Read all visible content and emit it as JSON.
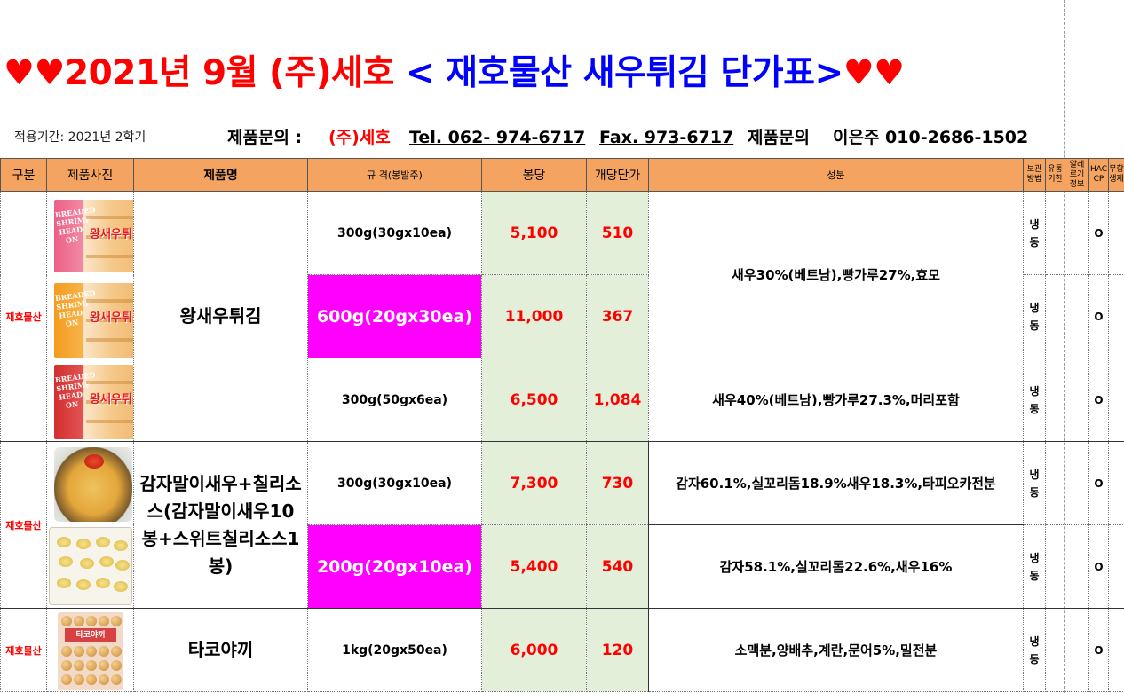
{
  "title": {
    "hearts_left": "♥♥",
    "red_part": "2021년 9월 (주)세호",
    "blue_part": "< 재호물산 새우튀김 단가표>",
    "hearts_right": "♥♥"
  },
  "info": {
    "period": "적용기간: 2021년 2학기",
    "inquiry_label": "제품문의 :",
    "company": "(주)세호",
    "tel": "Tel. 062- 974-6717",
    "fax": "Fax. 973-6717",
    "inquiry_label2": "제품문의",
    "contact": "이은주 010-2686-1502"
  },
  "headers": {
    "gubun": "구분",
    "photo": "제품사진",
    "name": "제품명",
    "spec": "규 격(봉발주)",
    "bongdang": "봉당",
    "unit_price": "개당단가",
    "ingredients": "성분",
    "storage": "보관 방법",
    "expiry": "유통 기한",
    "allergy": "알레 르기 정보",
    "haccp": "HAC CP",
    "gmo": "무항 생제"
  },
  "colors": {
    "header_bg": "#f4a460",
    "price_bg": "#e3efd9",
    "highlight": "#ff00ff",
    "accent_red": "#ff0000",
    "accent_blue": "#0000ff"
  },
  "products": [
    {
      "gubun": "재호물산",
      "name": "왕새우튀김",
      "rows": [
        {
          "spec": "300g(30gx10ea)",
          "price": "5,100",
          "unit": "510",
          "storage": "냉\n동",
          "haccp": "O",
          "highlight": false
        },
        {
          "spec": "600g(20gx30ea)",
          "price": "11,000",
          "unit": "367",
          "storage": "냉\n동",
          "haccp": "O",
          "highlight": true
        },
        {
          "spec": "300g(50gx6ea)",
          "price": "6,500",
          "unit": "1,084",
          "storage": "냉\n동",
          "haccp": "O",
          "highlight": false
        }
      ],
      "ingredients": [
        "새우30%(베트남),빵가루27%,효모",
        "새우40%(베트남),빵가루27.3%,머리포함"
      ]
    },
    {
      "gubun": "재호물산",
      "name": "감자말이새우+칠리소스(감자말이새우10봉+스위트칠리소스1봉)",
      "rows": [
        {
          "spec": "300g(30gx10ea)",
          "price": "7,300",
          "unit": "730",
          "storage": "냉\n동",
          "haccp": "O",
          "highlight": false
        },
        {
          "spec": "200g(20gx10ea)",
          "price": "5,400",
          "unit": "540",
          "storage": "냉\n동",
          "haccp": "O",
          "highlight": true
        }
      ],
      "ingredients": [
        "감자60.1%,실꼬리돔18.9%새우18.3%,타피오카전분",
        "감자58.1%,실꼬리돔22.6%,새우16%"
      ]
    },
    {
      "gubun": "재호물산",
      "name": "타코야끼",
      "rows": [
        {
          "spec": "1kg(20gx50ea)",
          "price": "6,000",
          "unit": "120",
          "storage": "냉\n동",
          "haccp": "O",
          "highlight": false
        }
      ],
      "ingredients": [
        "소맥분,양배추,계란,문어5%,밀전분"
      ]
    }
  ],
  "package_text": {
    "shrimp_en": "BREADED SHRIMP HEAD ON",
    "shrimp_kr": "왕새우튀김",
    "tako_kr": "타코야끼"
  }
}
